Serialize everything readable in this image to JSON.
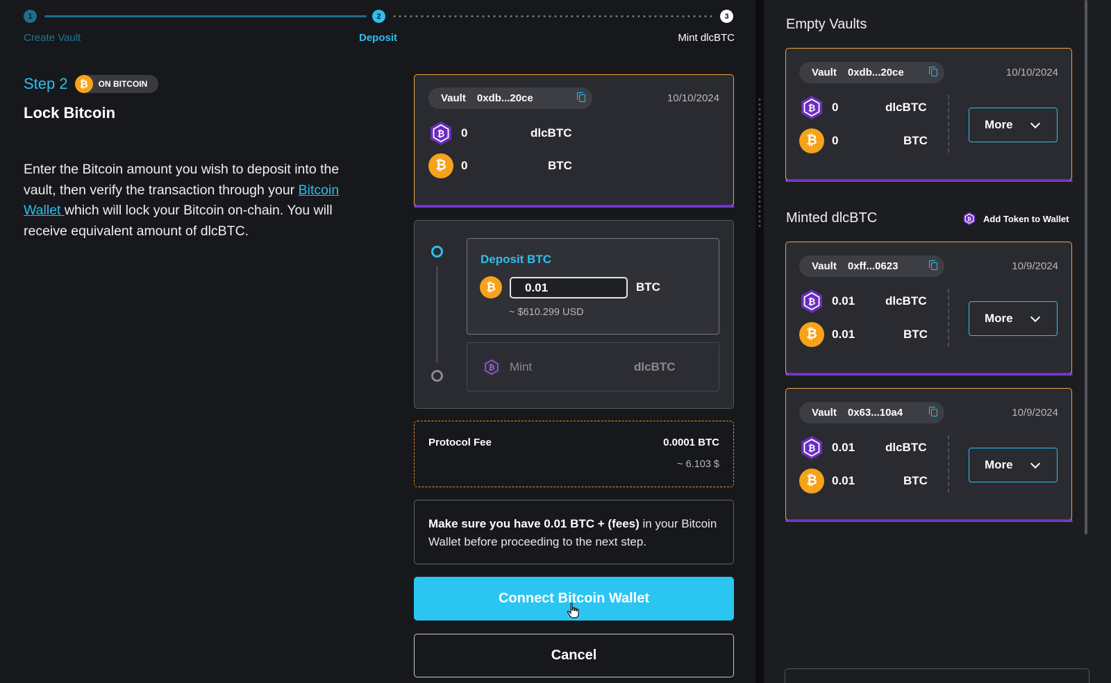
{
  "stepper": {
    "steps": [
      {
        "num": "1",
        "label": "Create Vault"
      },
      {
        "num": "2",
        "label": "Deposit"
      },
      {
        "num": "3",
        "label": "Mint dlcBTC"
      }
    ]
  },
  "step_header": {
    "step": "Step 2",
    "chip": "ON BITCOIN"
  },
  "title": "Lock Bitcoin",
  "description": {
    "before": "Enter the Bitcoin amount you wish to deposit into the vault, then verify the transaction through your ",
    "link": "Bitcoin Wallet ",
    "after": "which will lock your Bitcoin on-chain. You will receive equivalent amount of dlcBTC."
  },
  "current_vault": {
    "label": "Vault",
    "address": "0xdb...20ce",
    "date": "10/10/2024",
    "dlc_amount": "0",
    "dlc_token": "dlcBTC",
    "btc_amount": "0",
    "btc_token": "BTC"
  },
  "deposit": {
    "title": "Deposit BTC",
    "value": "0.01",
    "unit": "BTC",
    "usd": "~ $610.299 USD",
    "mint_label": "Mint",
    "mint_token": "dlcBTC"
  },
  "fee": {
    "label": "Protocol Fee",
    "value": "0.0001 BTC",
    "usd": "~ 6.103 $"
  },
  "note": {
    "bold": "Make sure you have 0.01 BTC + (fees)",
    "rest": " in your Bitcoin Wallet before proceeding to the next step."
  },
  "buttons": {
    "connect": "Connect Bitcoin Wallet",
    "cancel": "Cancel"
  },
  "sidebar": {
    "empty_title": "Empty Vaults",
    "minted_title": "Minted dlcBTC",
    "add_token": "Add Token to Wallet",
    "more_label": "More",
    "vaults": [
      {
        "label": "Vault",
        "address": "0xdb...20ce",
        "date": "10/10/2024",
        "dlc_amount": "0",
        "dlc_token": "dlcBTC",
        "btc_amount": "0",
        "btc_token": "BTC"
      },
      {
        "label": "Vault",
        "address": "0xff...0623",
        "date": "10/9/2024",
        "dlc_amount": "0.01",
        "dlc_token": "dlcBTC",
        "btc_amount": "0.01",
        "btc_token": "BTC"
      },
      {
        "label": "Vault",
        "address": "0x63...10a4",
        "date": "10/9/2024",
        "dlc_amount": "0.01",
        "dlc_token": "dlcBTC",
        "btc_amount": "0.01",
        "btc_token": "BTC"
      }
    ]
  },
  "colors": {
    "accent": "#2bc0ee",
    "btc": "#f7a21b",
    "dlc": "#6b2cbf",
    "border_orange": "#f0a445"
  }
}
